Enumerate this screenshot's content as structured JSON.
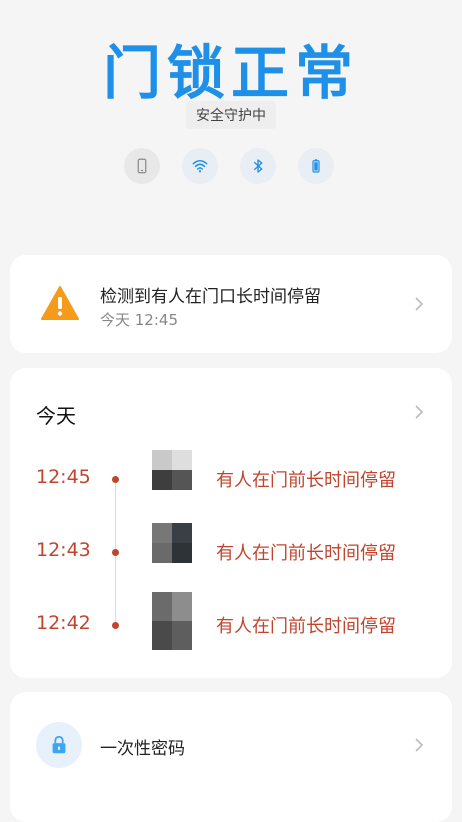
{
  "header": {
    "title": "门锁正常",
    "subtitle": "安全守护中",
    "status_icons": [
      "phone-icon",
      "wifi-icon",
      "bluetooth-icon",
      "battery-icon"
    ],
    "accent_color": "#1e90e8"
  },
  "alert": {
    "title": "检测到有人在门口长时间停留",
    "time": "今天 12:45",
    "warning_color": "#f59a1b"
  },
  "today": {
    "title": "今天",
    "events": [
      {
        "time": "12:45",
        "text": "有人在门前长时间停留"
      },
      {
        "time": "12:43",
        "text": "有人在门前长时间停留"
      },
      {
        "time": "12:42",
        "text": "有人在门前长时间停留"
      }
    ],
    "event_color": "#c0452f"
  },
  "otp": {
    "label": "一次性密码"
  }
}
